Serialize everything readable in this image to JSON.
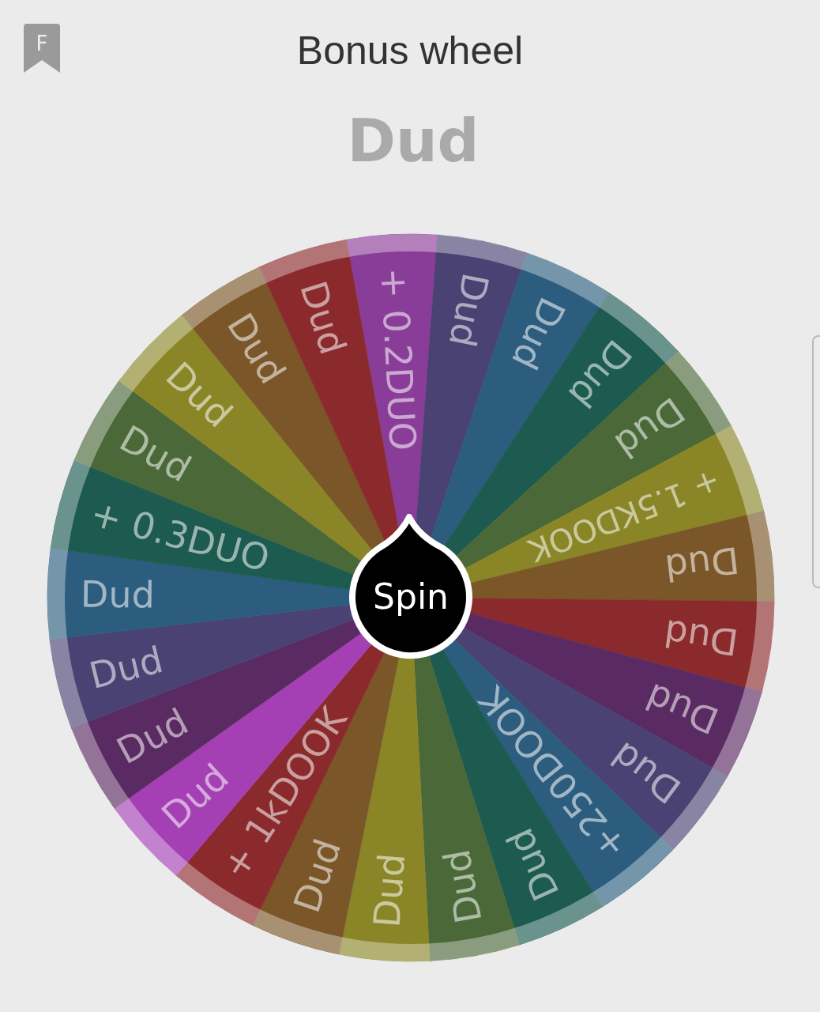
{
  "header": {
    "badge_letter": "F",
    "title": "Bonus wheel"
  },
  "result": "Dud",
  "wheel": {
    "spin_label": "Spin",
    "segments": [
      {
        "label": "+ 0.2DUO",
        "color": "#8a3d98"
      },
      {
        "label": "Dud",
        "color": "#4a4272"
      },
      {
        "label": "Dud",
        "color": "#2c5c7e"
      },
      {
        "label": "Dud",
        "color": "#1d5a50"
      },
      {
        "label": "Dud",
        "color": "#4a6838"
      },
      {
        "label": "+ 1.5KDOOK",
        "color": "#8a8628"
      },
      {
        "label": "Dud",
        "color": "#7a5628"
      },
      {
        "label": "Dud",
        "color": "#8a2a2c"
      },
      {
        "label": "Dud",
        "color": "#5a2a62"
      },
      {
        "label": "Dud",
        "color": "#4a4272"
      },
      {
        "label": "+250DOOK",
        "color": "#2c5c7e"
      },
      {
        "label": "Dud",
        "color": "#1d5a50"
      },
      {
        "label": "Dud",
        "color": "#4a6838"
      },
      {
        "label": "Dud",
        "color": "#8a8628"
      },
      {
        "label": "Dud",
        "color": "#7a5628"
      },
      {
        "label": "+ 1kDOOK",
        "color": "#8a2a2c"
      },
      {
        "label": "Dud",
        "color": "#a440b4"
      },
      {
        "label": "Dud",
        "color": "#5a2a62"
      },
      {
        "label": "Dud",
        "color": "#4a4272"
      },
      {
        "label": "Dud",
        "color": "#2c5c7e"
      },
      {
        "label": "+ 0.3DUO",
        "color": "#1d5a50"
      },
      {
        "label": "Dud",
        "color": "#4a6838"
      },
      {
        "label": "Dud",
        "color": "#8a8628"
      },
      {
        "label": "Dud",
        "color": "#7a5628"
      },
      {
        "label": "Dud",
        "color": "#8a2a2c"
      }
    ]
  }
}
